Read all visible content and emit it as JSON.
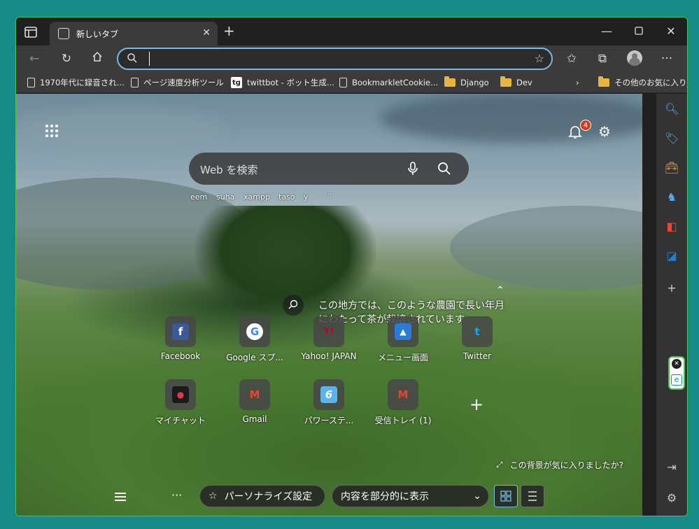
{
  "tab": {
    "title": "新しいタブ"
  },
  "address": {
    "value": "",
    "placeholder": ""
  },
  "bookmarks": [
    {
      "label": "1970年代に録音され...",
      "type": "page"
    },
    {
      "label": "ページ速度分析ツール",
      "type": "page"
    },
    {
      "label": "twittbot - ボット生成...",
      "type": "tg"
    },
    {
      "label": "BookmarkletCookie...",
      "type": "page"
    },
    {
      "label": "Django",
      "type": "folder"
    },
    {
      "label": "Dev",
      "type": "folder"
    },
    {
      "label": "その他のお気に入り",
      "type": "folder"
    }
  ],
  "newtab": {
    "notification_count": "4",
    "search_placeholder": "Web を検索",
    "quick_searches": [
      "eem",
      "suha",
      "xampp",
      "taso",
      "y"
    ],
    "more": "···",
    "caption": "この地方では、このような農園で長い年月にわたって茶が栽培されています",
    "tiles": [
      {
        "label": "Facebook",
        "glyph": "f",
        "color": "#3b5998"
      },
      {
        "label": "Google スプ...",
        "glyph": "G",
        "color": "#ffffff"
      },
      {
        "label": "Yahoo! JAPAN",
        "glyph": "Y!",
        "color": "#c4002f"
      },
      {
        "label": "メニュー画面",
        "glyph": "▲",
        "color": "#2a7bd6"
      },
      {
        "label": "Twitter",
        "glyph": "t",
        "color": "#1da1f2"
      },
      {
        "label": "マイチャット",
        "glyph": "●",
        "color": "#1a1a1a"
      },
      {
        "label": "Gmail",
        "glyph": "M",
        "color": "#ea4335"
      },
      {
        "label": "パワーステ...",
        "glyph": "6",
        "color": "#5ab4f0"
      },
      {
        "label": "受信トレイ (1)",
        "glyph": "M",
        "color": "#ea4335"
      }
    ],
    "bg_question": "この背景が気に入りましたか?",
    "personalize": "パーソナライズ設定",
    "content_display": "内容を部分的に表示"
  },
  "colors": {
    "accent": "#76b9ed",
    "window_border": "#4ec44e",
    "badge": "#d13b1a"
  }
}
